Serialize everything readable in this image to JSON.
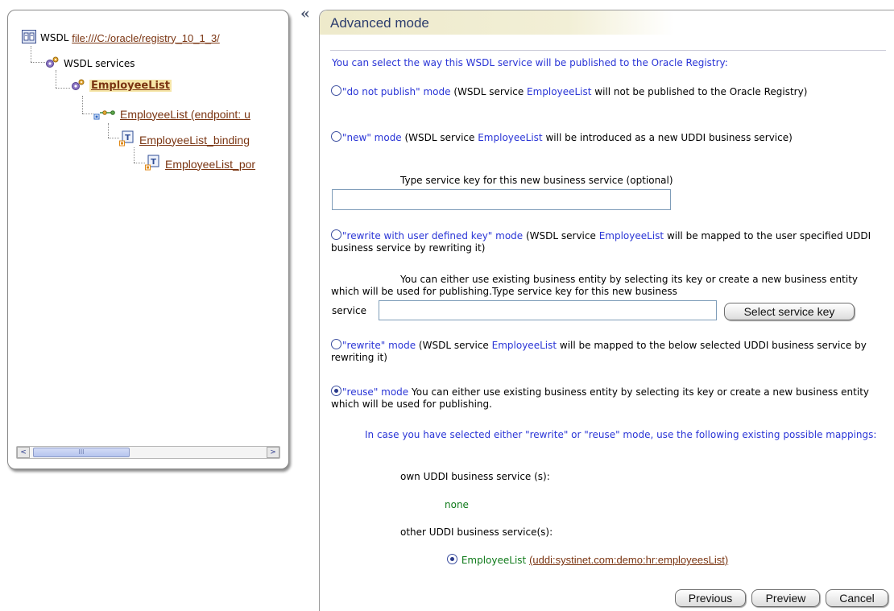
{
  "tree": {
    "root": {
      "prefix": "WSDL",
      "link": "file:///C:/oracle/registry_10_1_3/"
    },
    "services_label": "WSDL services",
    "service_name": "EmployeeList",
    "endpoint_link": "EmployeeList (endpoint: u",
    "binding_link": "EmployeeList_binding",
    "port_link": "EmployeeList_por"
  },
  "scrollbar": {
    "thumb_grip": "III",
    "left_arrow": "<",
    "right_arrow": ">"
  },
  "collapse_toggle": "«",
  "panel": {
    "title": "Advanced mode",
    "intro": "You can select the way this WSDL service will be published to the Oracle Registry:"
  },
  "options": {
    "do_not_publish": {
      "mode": "\"do not publish\" mode",
      "pre": " (WSDL service ",
      "service": "EmployeeList",
      "post": " will not be published to the Oracle Registry)"
    },
    "new": {
      "mode": "\"new\" mode",
      "pre": " (WSDL service ",
      "service": "EmployeeList",
      "post": " will be introduced as a new UDDI business service)",
      "key_label": "Type service key for this new business service (optional)",
      "key_value": ""
    },
    "rewrite_user_key": {
      "mode": "\"rewrite with user defined key\" mode",
      "pre": " (WSDL service ",
      "service": "EmployeeList",
      "post": " will be mapped to the user specified UDDI business service by rewriting it)",
      "note": "You can either use existing business entity by selecting its key or create a new business entity which will be used for publishing.Type service key for this new business",
      "service_label": "service",
      "key_value": "",
      "select_key_button": "Select service key"
    },
    "rewrite": {
      "mode": "\"rewrite\" mode",
      "pre": " (WSDL service ",
      "service": "EmployeeList",
      "post": " will be mapped to the below selected UDDI business service by rewriting it)"
    },
    "reuse": {
      "mode": "\"reuse\" mode",
      "post": " You can either use existing business entity by selecting its key or create a new business entity which will be used for publishing.",
      "selected": true
    }
  },
  "mappings": {
    "heading": "In case you have selected either \"rewrite\" or \"reuse\" mode, use the following existing possible mappings:",
    "own_label": "own UDDI business service (s):",
    "own_value": "none",
    "other_label": "other UDDI business service(s):",
    "other_name": "EmployeeList",
    "other_key": "(uddi:systinet.com:demo:hr:employeesList)"
  },
  "buttons": {
    "previous": "Previous",
    "preview": "Preview",
    "cancel": "Cancel"
  }
}
